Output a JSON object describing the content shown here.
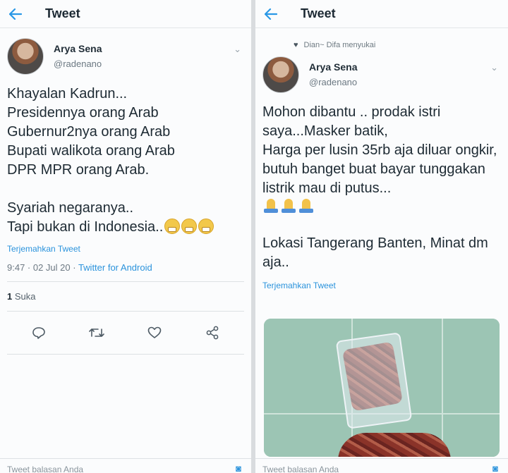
{
  "left": {
    "header_title": "Tweet",
    "author_name": "Arya Sena",
    "author_handle": "@radenano",
    "body": "Khayalan Kadrun...\nPresidennya orang Arab\nGubernur2nya orang Arab\nBupati walikota orang Arab\nDPR MPR orang Arab.\n\nSyariah negaranya..\nTapi bukan di Indonesia..",
    "translate_label": "Terjemahkan Tweet",
    "timestamp": "9:47 · 02 Jul 20 · ",
    "source": "Twitter for Android",
    "likes_count": "1",
    "likes_label": "Suka",
    "reply_placeholder": "Tweet balasan Anda"
  },
  "right": {
    "header_title": "Tweet",
    "social_context": "Dian~ Difa menyukai",
    "author_name": "Arya Sena",
    "author_handle": "@radenano",
    "body_1": "Mohon dibantu .. prodak istri saya...Masker batik,\nHarga per lusin 35rb aja diluar ongkir, butuh banget buat bayar tunggakan listrik mau di putus...",
    "body_2": "Lokasi Tangerang Banten, Minat dm aja..",
    "translate_label": "Terjemahkan Tweet",
    "reply_placeholder": "Tweet balasan Anda"
  },
  "icons": {
    "back": "arrow-left-icon",
    "chevron": "chevron-down-icon",
    "reply": "reply-icon",
    "retweet": "retweet-icon",
    "like": "heart-icon",
    "share": "share-icon",
    "camera": "camera-icon"
  },
  "colors": {
    "accent": "#2b93dc",
    "text": "#1d2a33",
    "muted": "#6d7983"
  }
}
